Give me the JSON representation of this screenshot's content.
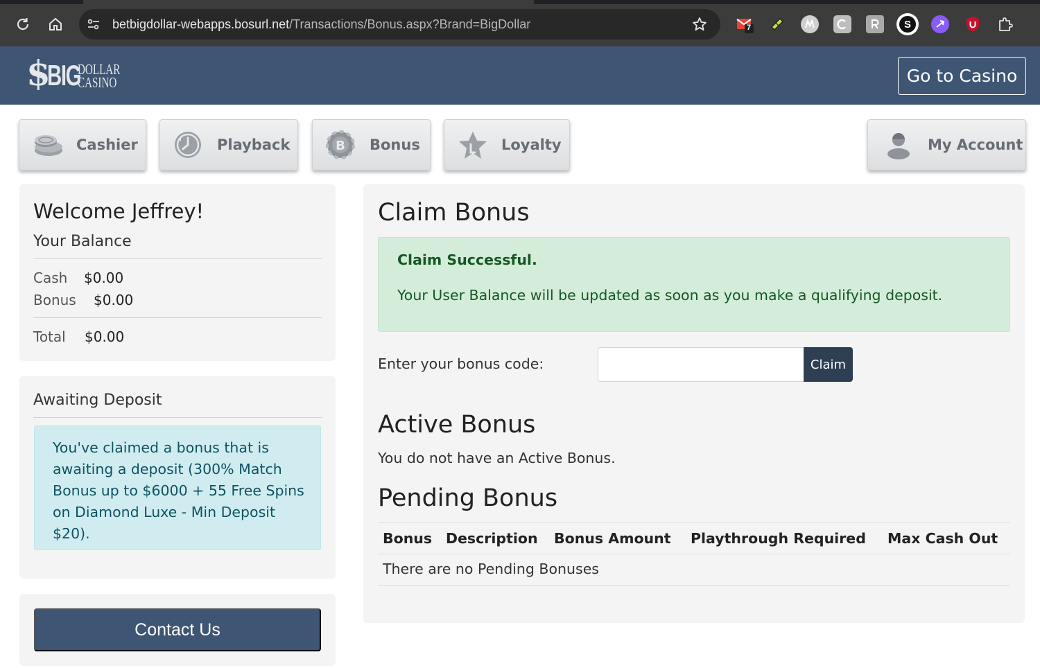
{
  "browser": {
    "url_main": "betbigdollar-webapps.bosurl.net",
    "url_path": "/Transactions/Bonus.aspx?Brand=BigDollar",
    "gmail_badge": "7",
    "ext_s_label": "S"
  },
  "header": {
    "logo_dollar_sign": "$",
    "logo_big": "BIG",
    "logo_dollar": "DOLLAR",
    "logo_casino": "CASINO",
    "go_casino_label": "Go to Casino"
  },
  "nav": {
    "cashier": "Cashier",
    "playback": "Playback",
    "bonus": "Bonus",
    "loyalty": "Loyalty",
    "my_account": "My Account"
  },
  "sidebar": {
    "welcome": "Welcome Jeffrey!",
    "balance_title": "Your Balance",
    "cash_label": "Cash",
    "cash_value": "$0.00",
    "bonus_label": "Bonus",
    "bonus_value": "$0.00",
    "total_label": "Total",
    "total_value": "$0.00",
    "awaiting_title": "Awaiting Deposit",
    "awaiting_message": "You've claimed a bonus that is awaiting a deposit (300% Match Bonus up to $6000 + 55 Free Spins on Diamond Luxe - Min Deposit $20).",
    "contact_label": "Contact Us"
  },
  "main": {
    "claim_title": "Claim Bonus",
    "success_title": "Claim Successful.",
    "success_message": "Your User Balance will be updated as soon as you make a qualifying deposit.",
    "code_label": "Enter your bonus code:",
    "code_value": "",
    "claim_button": "Claim",
    "active_title": "Active Bonus",
    "active_message": "You do not have an Active Bonus.",
    "pending_title": "Pending Bonus",
    "pending_columns": [
      "Bonus",
      "Description",
      "Bonus Amount",
      "Playthrough Required",
      "Max Cash Out"
    ],
    "pending_empty": "There are no Pending Bonuses"
  },
  "colors": {
    "header_bg": "#3e5573",
    "success_bg": "#d4edda",
    "info_bg": "#d1ecf1",
    "claim_btn": "#2e3f53"
  }
}
